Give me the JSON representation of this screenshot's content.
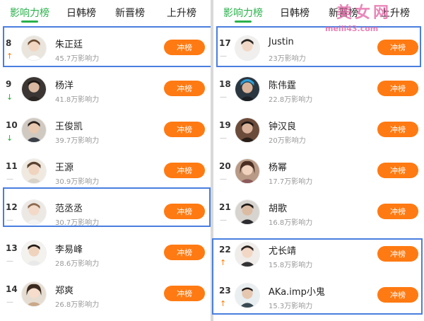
{
  "tabs": [
    {
      "label": "影响力榜",
      "active": true
    },
    {
      "label": "日韩榜",
      "active": false
    },
    {
      "label": "新晋榜",
      "active": false
    },
    {
      "label": "上升榜",
      "active": false
    }
  ],
  "rush_label": "冲榜",
  "left_list": [
    {
      "rank": "8",
      "name": "朱正廷",
      "influence": "45.7万影响力",
      "trend": "up"
    },
    {
      "rank": "9",
      "name": "杨洋",
      "influence": "41.8万影响力",
      "trend": "down"
    },
    {
      "rank": "10",
      "name": "王俊凯",
      "influence": "39.7万影响力",
      "trend": "down"
    },
    {
      "rank": "11",
      "name": "王源",
      "influence": "30.9万影响力",
      "trend": "flat"
    },
    {
      "rank": "12",
      "name": "范丞丞",
      "influence": "30.7万影响力",
      "trend": "flat"
    },
    {
      "rank": "13",
      "name": "李易峰",
      "influence": "28.6万影响力",
      "trend": "flat"
    },
    {
      "rank": "14",
      "name": "郑爽",
      "influence": "26.8万影响力",
      "trend": "flat"
    }
  ],
  "right_list": [
    {
      "rank": "17",
      "name": "Justin",
      "influence": "23万影响力",
      "trend": "flat"
    },
    {
      "rank": "18",
      "name": "陈伟霆",
      "influence": "22.8万影响力",
      "trend": "flat"
    },
    {
      "rank": "19",
      "name": "钟汉良",
      "influence": "20万影响力",
      "trend": "flat"
    },
    {
      "rank": "20",
      "name": "杨幂",
      "influence": "17.7万影响力",
      "trend": "flat"
    },
    {
      "rank": "21",
      "name": "胡歌",
      "influence": "16.8万影响力",
      "trend": "flat"
    },
    {
      "rank": "22",
      "name": "尤长靖",
      "influence": "15.8万影响力",
      "trend": "up"
    },
    {
      "rank": "23",
      "name": "AKa.imp小鬼",
      "influence": "15.3万影响力",
      "trend": "up"
    }
  ],
  "watermark": {
    "text": "美女网",
    "url": "meili43.com"
  },
  "colors": {
    "accent_green": "#2bb24c",
    "button_orange": "#ff7a12",
    "highlight_blue": "#4a7ee0",
    "trend_up": "#ff7a00",
    "trend_down": "#27a844"
  }
}
